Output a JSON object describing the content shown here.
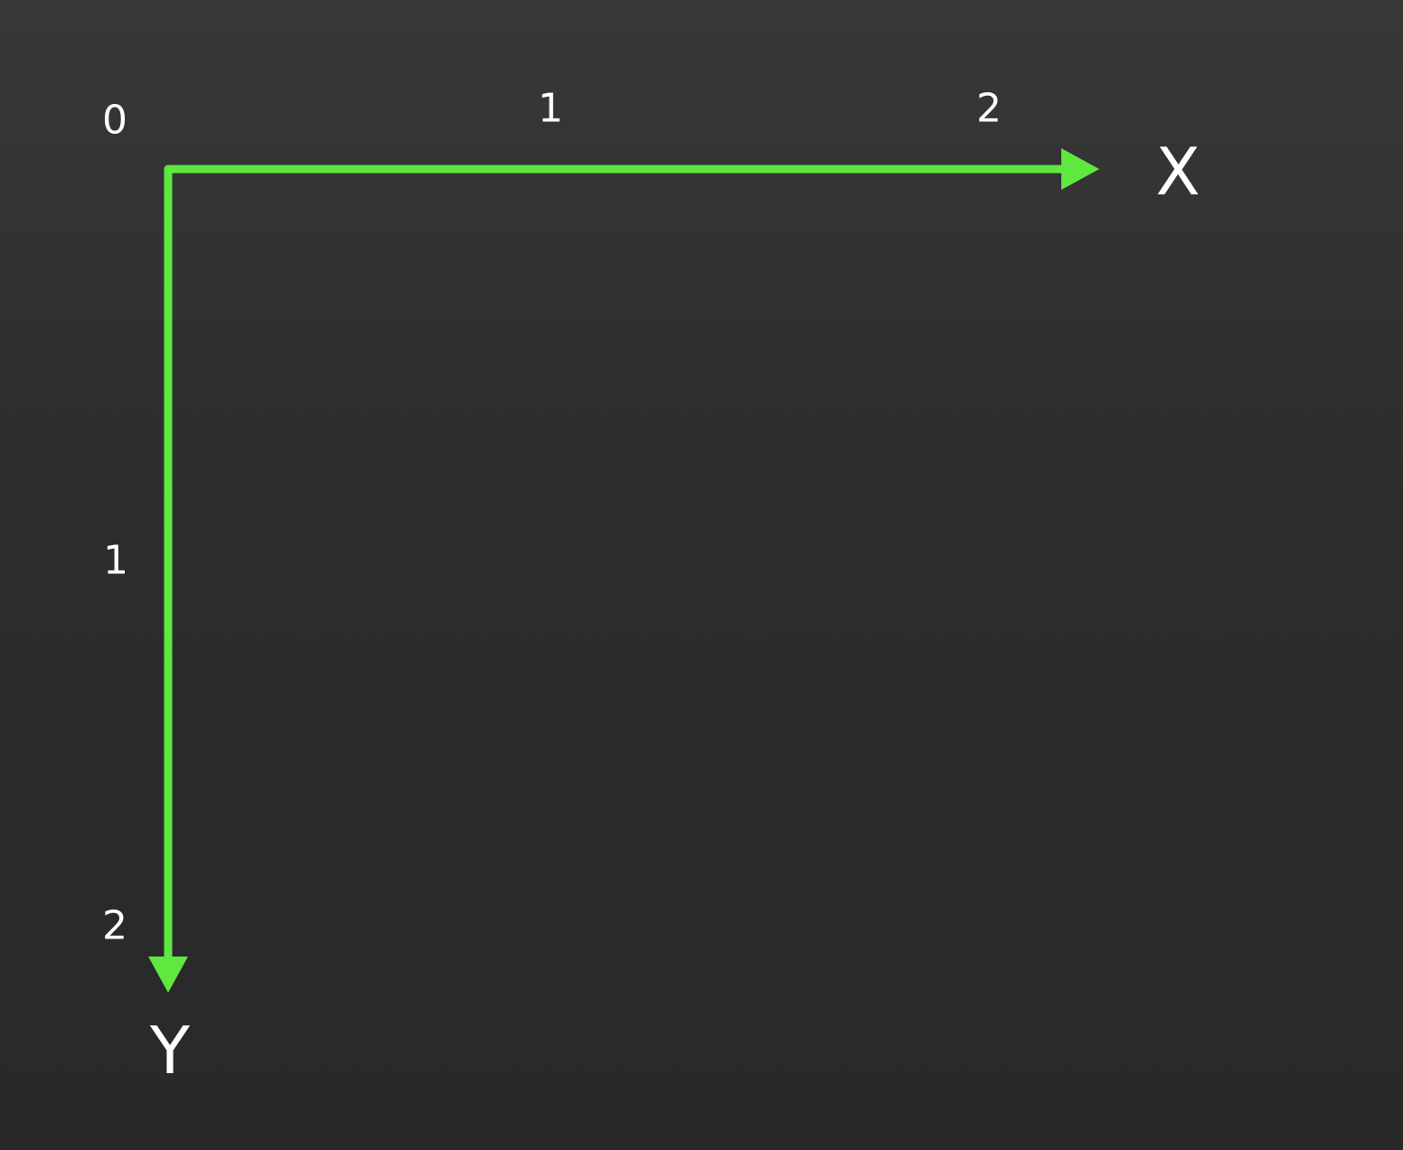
{
  "diagram": {
    "axis_color": "#5fe83f",
    "label_color": "#ffffff",
    "background_color": "#2e2e2e",
    "origin_label": "0",
    "x_axis": {
      "name": "X",
      "ticks": [
        "1",
        "2"
      ],
      "direction": "right"
    },
    "y_axis": {
      "name": "Y",
      "ticks": [
        "1",
        "2"
      ],
      "direction": "down"
    }
  }
}
